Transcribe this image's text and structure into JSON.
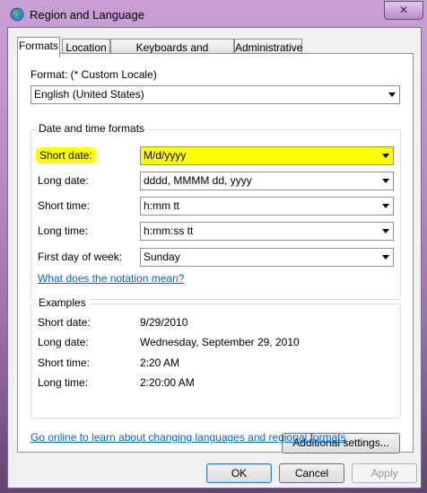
{
  "window": {
    "title": "Region and Language",
    "close_glyph": "✕"
  },
  "tabs": [
    {
      "label": "Formats"
    },
    {
      "label": "Location"
    },
    {
      "label": "Keyboards and Languages"
    },
    {
      "label": "Administrative"
    }
  ],
  "format": {
    "label": "Format: (* Custom Locale)",
    "selected": "English (United States)"
  },
  "date_time_formats": {
    "title": "Date and time formats",
    "rows": [
      {
        "label": "Short date:",
        "value": "M/d/yyyy"
      },
      {
        "label": "Long date:",
        "value": "dddd, MMMM dd, yyyy"
      },
      {
        "label": "Short time:",
        "value": "h:mm tt"
      },
      {
        "label": "Long time:",
        "value": "h:mm:ss tt"
      },
      {
        "label": "First day of week:",
        "value": "Sunday"
      }
    ],
    "notation_link": "What does the notation mean?"
  },
  "examples": {
    "title": "Examples",
    "rows": [
      {
        "label": "Short date:",
        "value": "9/29/2010"
      },
      {
        "label": "Long date:",
        "value": "Wednesday, September 29, 2010"
      },
      {
        "label": "Short time:",
        "value": "2:20 AM"
      },
      {
        "label": "Long time:",
        "value": "2:20:00 AM"
      }
    ]
  },
  "additional_settings": "Additional settings...",
  "online_link": "Go online to learn about changing languages and regional formats",
  "buttons": {
    "ok": "OK",
    "cancel": "Cancel",
    "apply": "Apply"
  },
  "highlight_color": "#ffff00",
  "link_color": "#0066cc"
}
